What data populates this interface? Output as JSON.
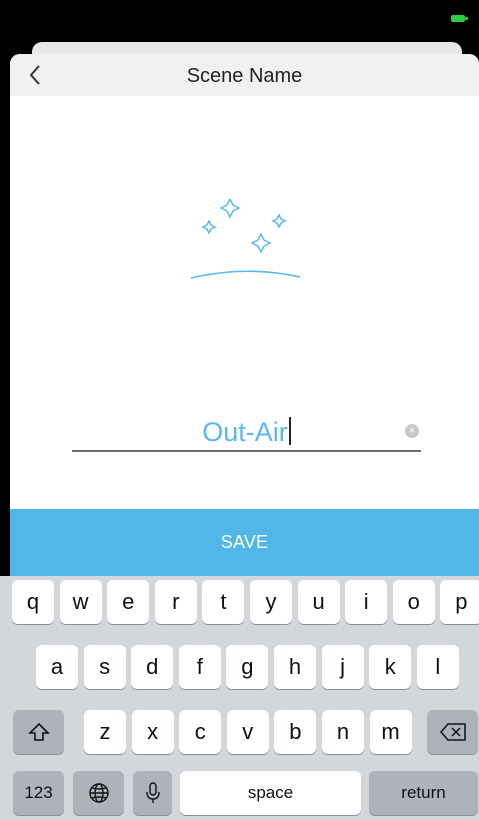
{
  "screen": {
    "title": "Scene Name",
    "name_value": "Out-Air",
    "save_label": "SAVE"
  },
  "icons": {
    "back": "chevron-left-icon",
    "clear": "clear-circle-icon",
    "shift": "shift-icon",
    "backspace": "backspace-icon",
    "globe": "globe-icon",
    "mic": "microphone-icon"
  },
  "colors": {
    "accent": "#51b7e8",
    "name_text": "#59b9ea",
    "keyboard_bg": "#d3d6db",
    "key": "#ffffff",
    "key_function": "#aeb3bb"
  },
  "keyboard": {
    "row1": [
      "q",
      "w",
      "e",
      "r",
      "t",
      "y",
      "u",
      "i",
      "o",
      "p"
    ],
    "row2": [
      "a",
      "s",
      "d",
      "f",
      "g",
      "h",
      "j",
      "k",
      "l"
    ],
    "row3": [
      "z",
      "x",
      "c",
      "v",
      "b",
      "n",
      "m"
    ],
    "numbers_label": "123",
    "space_label": "space",
    "return_label": "return"
  }
}
